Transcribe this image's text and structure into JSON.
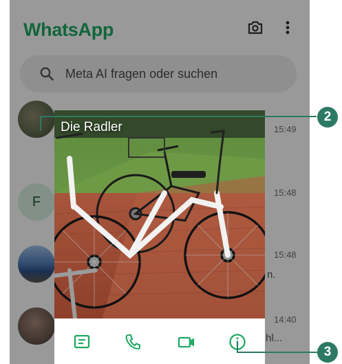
{
  "app": {
    "title": "WhatsApp"
  },
  "search": {
    "placeholder": "Meta AI fragen oder suchen"
  },
  "chats": [
    {
      "time": "15:49"
    },
    {
      "avatar_letter": "F",
      "time": "15:48"
    },
    {
      "time": "15:48",
      "snippet": "n."
    },
    {
      "time": "14:40",
      "snippet": "hl..."
    }
  ],
  "popup": {
    "name": "Die Radler",
    "actions": [
      "message-icon",
      "phone-icon",
      "video-icon",
      "info-icon"
    ]
  },
  "callouts": [
    "2",
    "3"
  ],
  "colors": {
    "brand": "#1daa61",
    "callout": "#2d7a64",
    "overlay": "rgba(0,0,0,0.40)"
  }
}
